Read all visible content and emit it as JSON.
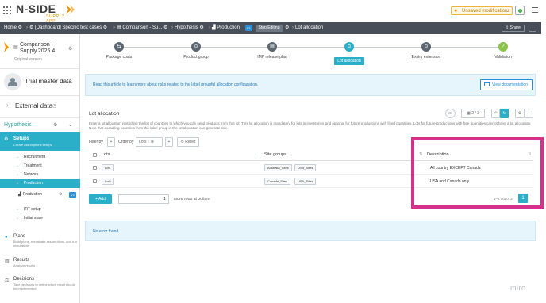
{
  "app": {
    "logo_text": "N-SIDE",
    "logo_sub": "SUPPLY APP",
    "unsaved_label": "Unsaved modifications"
  },
  "breadcrumb": {
    "home": "Home",
    "dashboard": "[Dashboard] Specific test cases",
    "comparison": "Comparison - Su...",
    "hypothesis": "Hypothesis",
    "production": "Production",
    "production_tag": "V1",
    "stop_editing": "Stop Editing",
    "current": "Lot allocation",
    "share": "Share"
  },
  "sidebar": {
    "scenario_name": "Comparison - Supply.2025.4",
    "scenario_sub": "Original version",
    "trial_master_data": "Trial master data",
    "external_data": "External data",
    "hypothesis": "Hypothesis",
    "setups_label": "Setups",
    "setups_sub": "Create assumptions setups",
    "items": [
      "Recruitment",
      "Treatment",
      "Network",
      "Production"
    ],
    "production_sub": "Production",
    "production_tag": "V1",
    "items2": [
      "IRT setup",
      "Initial state"
    ],
    "plans_label": "Plans",
    "plans_sub": "Build plans, reevaluate assumptions, and run simulations",
    "results_label": "Results",
    "results_sub": "Analyze results",
    "decisions_label": "Decisions",
    "decisions_sub": "Take decisions to define which result should be implemented"
  },
  "stepper": {
    "steps": [
      {
        "label": "Package costs",
        "glyph": "⇆"
      },
      {
        "label": "Product group",
        "glyph": "⊙"
      },
      {
        "label": "IMP release plan",
        "glyph": "▤"
      },
      {
        "label": "Lot allocation",
        "glyph": "⊙"
      },
      {
        "label": "Expiry extension",
        "glyph": "⊙"
      },
      {
        "label": "Validation",
        "glyph": "✓"
      }
    ]
  },
  "info": {
    "text": "Read this article to learn more about risks related to the label groupful allocation configuration.",
    "button": "View documentation"
  },
  "lot_allocation": {
    "title": "Lot allocation",
    "description": "Enter a lot allocation restricting the list of countries to which you can send products from that lot. This lot allocation is mandatory for lots in inventories and optional for future productions with fixed quantities. Lots for future productions with free quantities cannot have a lot allocation. Note that excluding countries from the label group in the lot allocation can generate risk.",
    "filter_by": "Filter by",
    "order_by": "Order by",
    "order_value": "Lots",
    "reset": "Reset",
    "count_label": "2 / 3",
    "columns": [
      "Lots",
      "Site groups",
      "Description"
    ],
    "rows": [
      {
        "lot": "Lot1",
        "sites": [
          "Australia_Sites",
          "USA_Sites"
        ],
        "description": "All country EXCEPT Canada"
      },
      {
        "lot": "Lot2",
        "sites": [
          "Canada_Sites",
          "USA_Sites"
        ],
        "description": "USA and Canada only"
      }
    ],
    "add_label": "Add",
    "rows_value": "1",
    "more_rows": "more rows at bottom",
    "pager": "1–2 out of 2",
    "page": "1"
  },
  "error": {
    "text": "No error found"
  },
  "watermark": "miro",
  "colors": {
    "accent": "#2bafc8",
    "highlight": "#d6308a",
    "brand_orange": "#f39200"
  }
}
